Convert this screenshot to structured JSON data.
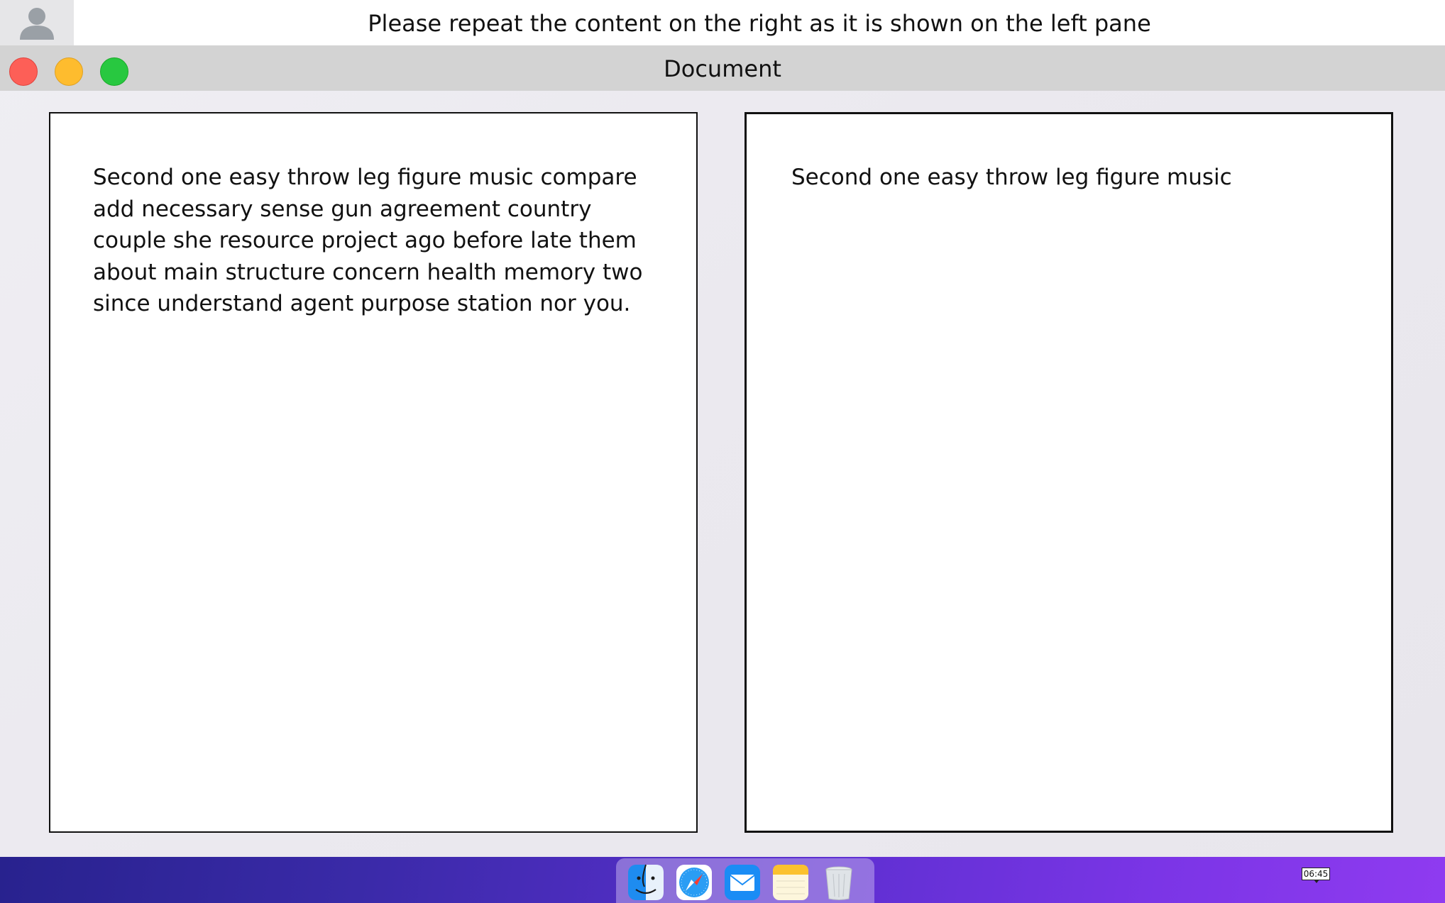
{
  "instruction": {
    "text": "Please repeat the content on the right as it is shown on the left pane"
  },
  "window": {
    "title": "Document"
  },
  "panes": {
    "left_text": "Second one easy throw leg figure music compare add necessary sense gun agreement country couple she resource project ago before late them about main structure concern health memory two since understand agent purpose station nor you.",
    "right_text": "Second one easy throw leg figure music"
  },
  "dock": {
    "items": [
      "finder-icon",
      "safari-icon",
      "mail-icon",
      "notes-icon",
      "trash-icon"
    ]
  },
  "taskbar": {
    "clock": "06:45"
  },
  "colors": {
    "close": "#fd5f57",
    "minimize": "#febc2e",
    "maximize": "#28c840",
    "title_bar": "#d3d3d3",
    "taskbar_start": "#28228e",
    "taskbar_end": "#8f3bf0"
  }
}
